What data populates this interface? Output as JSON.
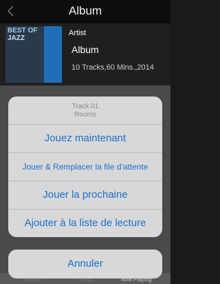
{
  "header": {
    "title": "Album"
  },
  "album": {
    "cover_text_line1": "BEST OF",
    "cover_text_line2": "JAZZ",
    "artist": "Artist",
    "name": "Album",
    "meta": "10 Tracks,60 Mins.,2014"
  },
  "action_sheet": {
    "track": "Track 01",
    "room": "Rooms",
    "options": [
      "Jouez maintenant",
      "Jouer & Remplacer la file d'attente",
      "Jouer la prochaine",
      "Ajouter à la liste de lecture"
    ],
    "cancel": "Annuler"
  },
  "tabs": [
    "Rooms",
    "Music",
    "Now Playing"
  ],
  "colors": {
    "accent": "#1b6fd0",
    "sheet": "#d8d8d8"
  }
}
